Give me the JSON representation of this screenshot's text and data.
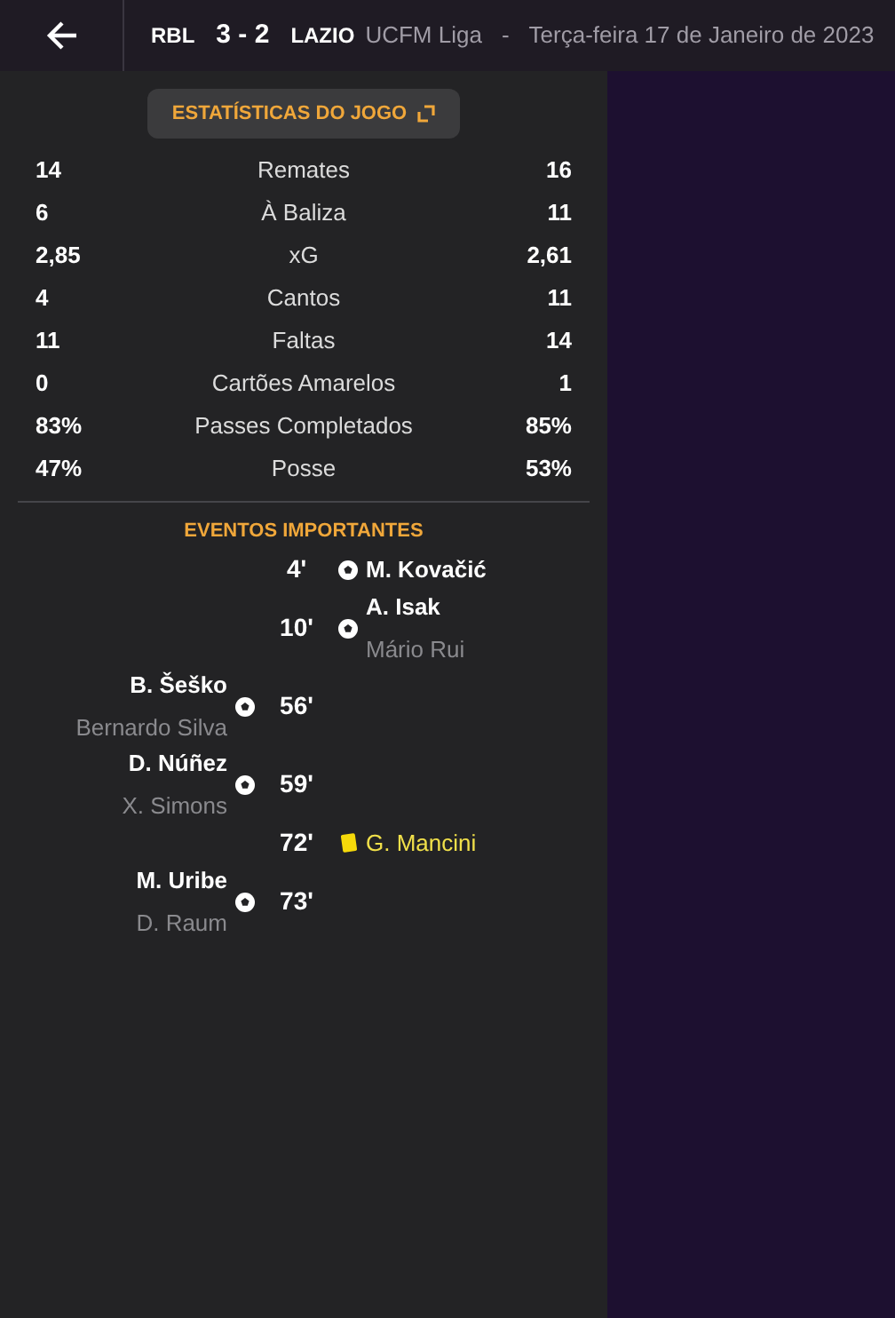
{
  "header": {
    "home": "RBL",
    "score": "3 - 2",
    "away": "LAZIO",
    "competition": "UCFM Liga",
    "separator": "-",
    "date": "Terça-feira 17 de Janeiro de 2023"
  },
  "stats_button": "ESTATÍSTICAS DO JOGO",
  "stats": [
    {
      "home": "14",
      "label": "Remates",
      "away": "16"
    },
    {
      "home": "6",
      "label": "À Baliza",
      "away": "11"
    },
    {
      "home": "2,85",
      "label": "xG",
      "away": "2,61"
    },
    {
      "home": "4",
      "label": "Cantos",
      "away": "11"
    },
    {
      "home": "11",
      "label": "Faltas",
      "away": "14"
    },
    {
      "home": "0",
      "label": "Cartões Amarelos",
      "away": "1"
    },
    {
      "home": "83%",
      "label": "Passes Completados",
      "away": "85%"
    },
    {
      "home": "47%",
      "label": "Posse",
      "away": "53%"
    }
  ],
  "events_title": "EVENTOS IMPORTANTES",
  "events": [
    {
      "home_team": false,
      "kind": "goal",
      "minute": "4'",
      "player": "M. Kovačić"
    },
    {
      "home_team": false,
      "kind": "goal",
      "minute": "10'",
      "player": "A. Isak",
      "assist": "Mário Rui"
    },
    {
      "home_team": true,
      "kind": "goal",
      "minute": "56'",
      "player": "B. Šeško",
      "assist": "Bernardo Silva"
    },
    {
      "home_team": true,
      "kind": "goal",
      "minute": "59'",
      "player": "D. Núñez",
      "assist": "X. Simons"
    },
    {
      "home_team": false,
      "kind": "yellow_card",
      "minute": "72'",
      "player": "G. Mancini"
    },
    {
      "home_team": true,
      "kind": "goal",
      "minute": "73'",
      "player": "M. Uribe",
      "assist": "D. Raum"
    }
  ]
}
